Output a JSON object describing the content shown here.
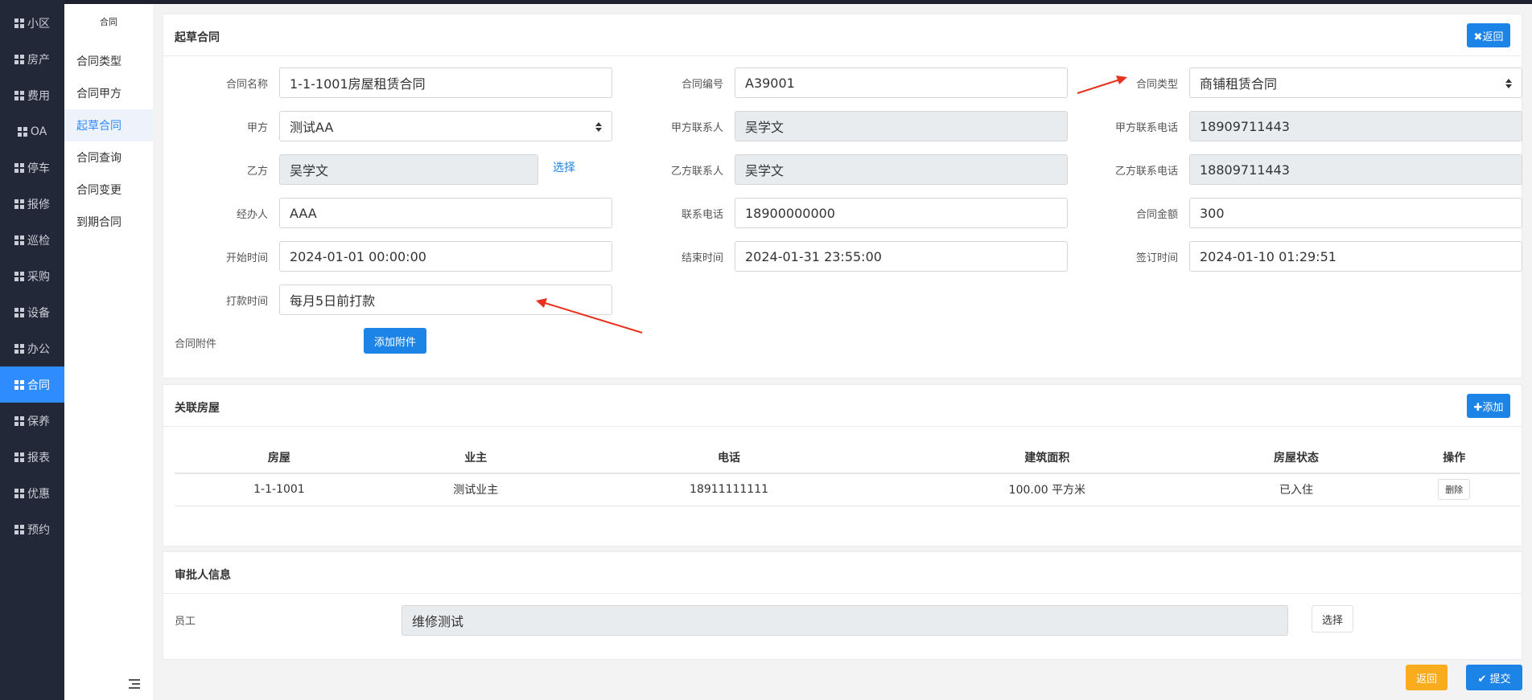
{
  "nav": {
    "items": [
      {
        "label": "小区",
        "active": false
      },
      {
        "label": "房产",
        "active": false
      },
      {
        "label": "费用",
        "active": false
      },
      {
        "label": "OA",
        "active": false
      },
      {
        "label": "停车",
        "active": false
      },
      {
        "label": "报修",
        "active": false
      },
      {
        "label": "巡检",
        "active": false
      },
      {
        "label": "采购",
        "active": false
      },
      {
        "label": "设备",
        "active": false
      },
      {
        "label": "办公",
        "active": false
      },
      {
        "label": "合同",
        "active": true
      },
      {
        "label": "保养",
        "active": false
      },
      {
        "label": "报表",
        "active": false
      },
      {
        "label": "优惠",
        "active": false
      },
      {
        "label": "预约",
        "active": false
      }
    ],
    "accent": "#2e8cff"
  },
  "subnav": {
    "title": "合同",
    "items": [
      {
        "label": "合同类型"
      },
      {
        "label": "合同甲方"
      },
      {
        "label": "起草合同",
        "active": true
      },
      {
        "label": "合同查询"
      },
      {
        "label": "合同变更"
      },
      {
        "label": "到期合同"
      }
    ]
  },
  "draft": {
    "title": "起草合同",
    "back_label": "✖返回",
    "fields": {
      "contract_name": {
        "label": "合同名称",
        "value": "1-1-1001房屋租赁合同"
      },
      "contract_no": {
        "label": "合同编号",
        "value": "A39001"
      },
      "contract_type": {
        "label": "合同类型",
        "value": "商铺租赁合同"
      },
      "party_a": {
        "label": "甲方",
        "value": "测试AA"
      },
      "party_a_contact": {
        "label": "甲方联系人",
        "value": "吴学文"
      },
      "party_a_phone": {
        "label": "甲方联系电话",
        "value": "18909711443"
      },
      "party_b": {
        "label": "乙方",
        "value": "吴学文",
        "select_label": "选择"
      },
      "party_b_contact": {
        "label": "乙方联系人",
        "value": "吴学文"
      },
      "party_b_phone": {
        "label": "乙方联系电话",
        "value": "18809711443"
      },
      "handler": {
        "label": "经办人",
        "value": "AAA"
      },
      "phone": {
        "label": "联系电话",
        "value": "18900000000"
      },
      "amount": {
        "label": "合同金额",
        "value": "300"
      },
      "start_time": {
        "label": "开始时间",
        "value": "2024-01-01 00:00:00"
      },
      "end_time": {
        "label": "结束时间",
        "value": "2024-01-31 23:55:00"
      },
      "sign_time": {
        "label": "签订时间",
        "value": "2024-01-10 01:29:51"
      },
      "pay_time": {
        "label": "打款时间",
        "value": "每月5日前打款"
      },
      "attachment": {
        "label": "合同附件",
        "button": "添加附件"
      }
    }
  },
  "rooms": {
    "title": "关联房屋",
    "add_label": "✚添加",
    "columns": [
      "房屋",
      "业主",
      "电话",
      "建筑面积",
      "房屋状态",
      "操作"
    ],
    "rows": [
      {
        "room": "1-1-1001",
        "owner": "测试业主",
        "phone": "18911111111",
        "area": "100.00 平方米",
        "status": "已入住",
        "action": "删除"
      }
    ]
  },
  "approver": {
    "title": "审批人信息",
    "label": "员工",
    "value": "维修测试",
    "select_label": "选择"
  },
  "footer": {
    "back_label": "返回",
    "submit_label": "✔ 提交"
  }
}
